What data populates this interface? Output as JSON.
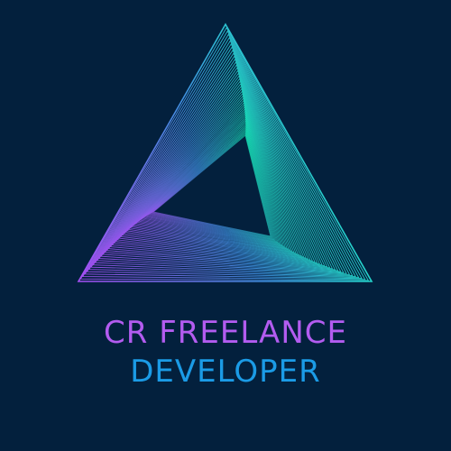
{
  "brand": {
    "line1": "CR FREELANCE",
    "line2": "DEVELOPER"
  },
  "colors": {
    "background": "#03203d",
    "line1_text": "#b35cf0",
    "line2_text": "#1b9be6",
    "gradient_start": "#a64ff5",
    "gradient_mid": "#3f8fe0",
    "gradient_end": "#19f2c2"
  },
  "logo": {
    "icon": "spiral-triangle-logo-icon"
  }
}
